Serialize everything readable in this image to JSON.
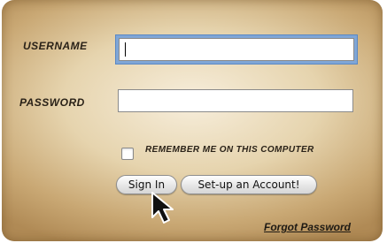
{
  "form": {
    "username_label": "USERNAME",
    "username_value": "",
    "password_label": "PASSWORD",
    "password_value": "",
    "remember_label": "REMEMBER ME ON THIS COMPUTER",
    "remember_checked": false,
    "signin_label": "Sign In",
    "setup_label": "Set-up an Account!",
    "forgot_label": "Forgot Password"
  },
  "icons": {
    "pointer": "arrow-cursor-icon"
  },
  "colors": {
    "panel_center": "#f7eedc",
    "panel_edge": "#b08a55",
    "focus_ring": "#7fa6d6"
  }
}
